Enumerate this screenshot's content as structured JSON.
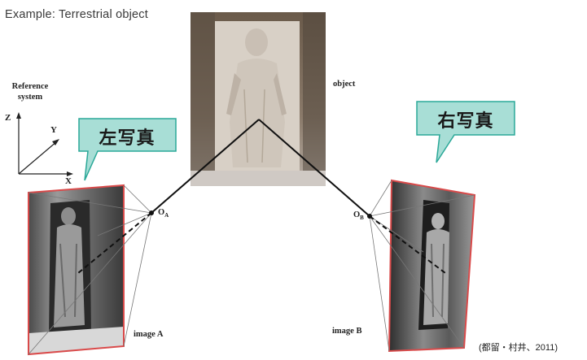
{
  "title": "Example: Terrestrial object",
  "reference_system": {
    "label": "Reference system",
    "axis_z": "Z",
    "axis_y": "Y",
    "axis_x": "X"
  },
  "object_label": "object",
  "image_a_label": "image A",
  "image_b_label": "image B",
  "origin_a": {
    "main": "O",
    "sub": "A"
  },
  "origin_b": {
    "main": "O",
    "sub": "B"
  },
  "callout_left": "左写真",
  "callout_right": "右写真",
  "citation": "(都留・村井、2011)",
  "colors": {
    "callout_fill": "#a8ded6",
    "callout_stroke": "#2aa898",
    "photo_frame": "#d94a4a"
  }
}
